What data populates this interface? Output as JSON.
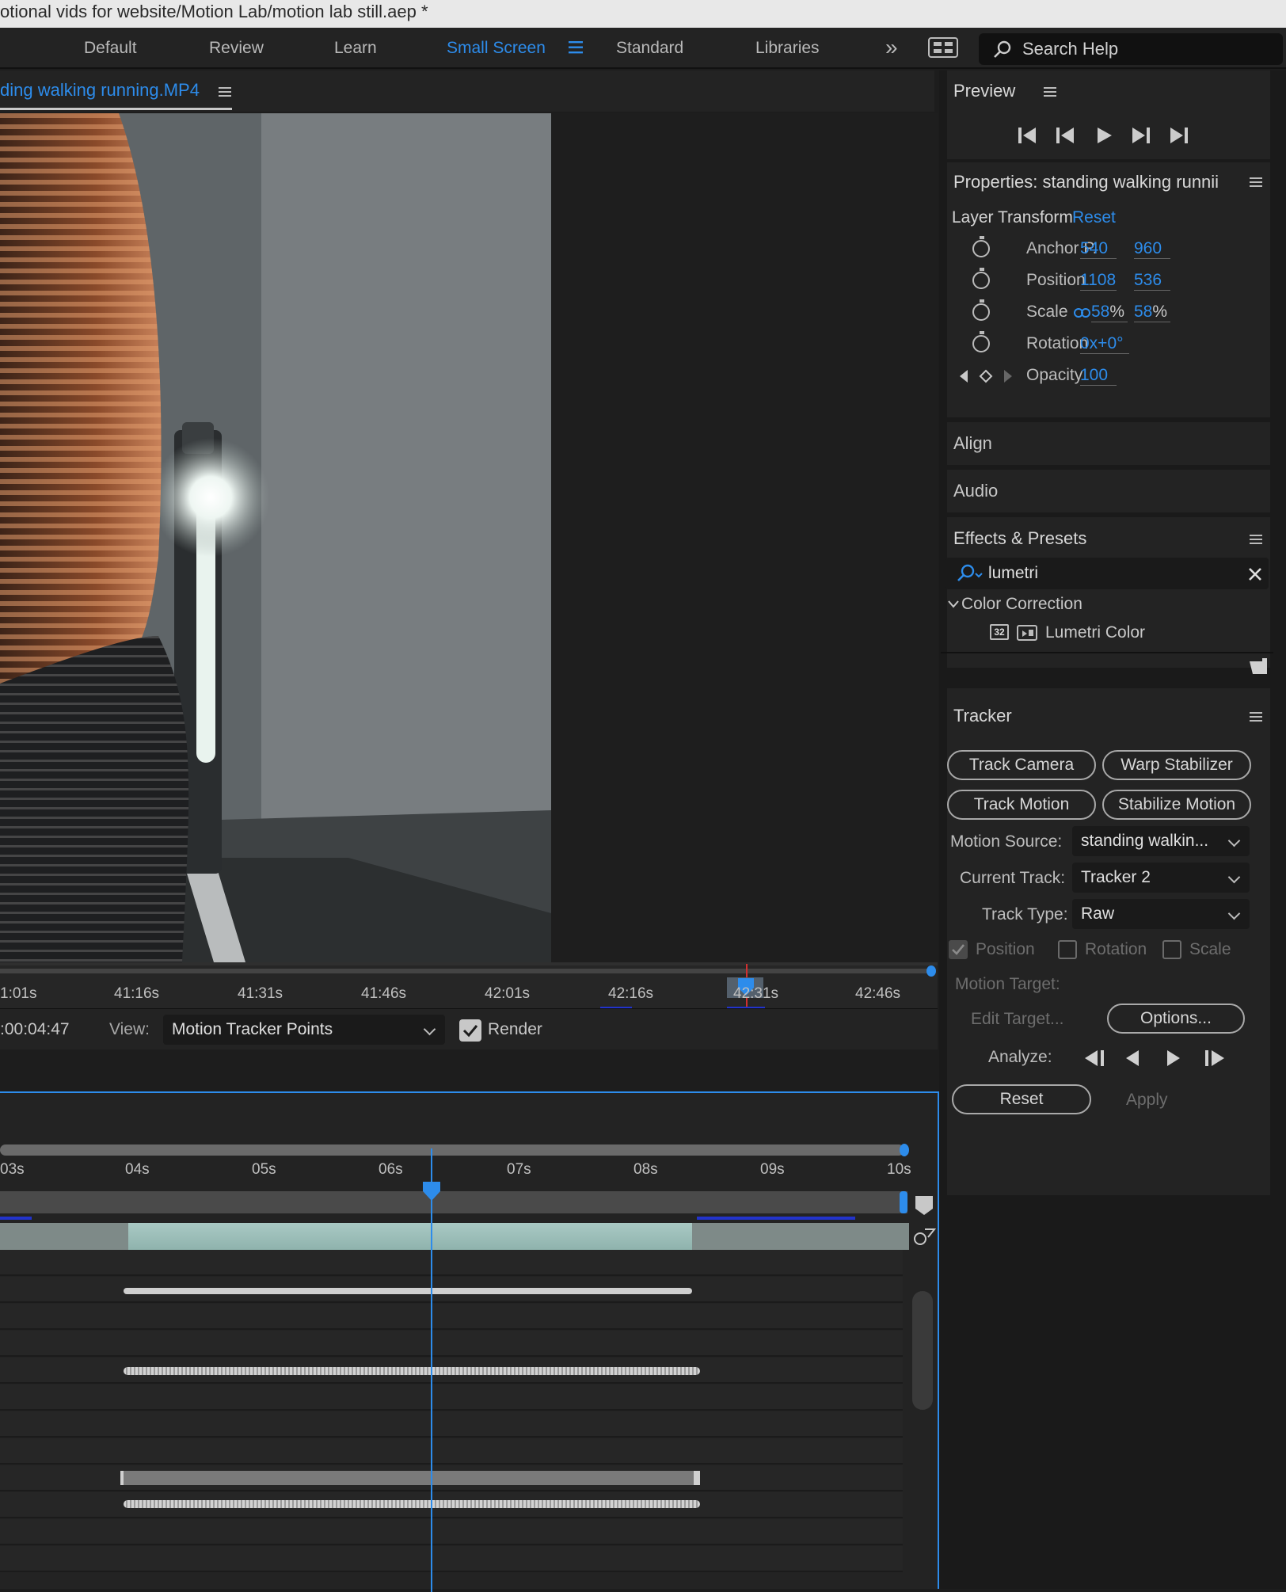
{
  "title_bar": {
    "text": "otional vids for website/Motion Lab/motion lab still.aep *"
  },
  "workspaces": {
    "items": [
      "Default",
      "Review",
      "Learn",
      "Small Screen",
      "Standard",
      "Libraries"
    ],
    "active": "Small Screen",
    "more_glyph": "»"
  },
  "search_help": {
    "placeholder": "Search Help"
  },
  "footage_panel": {
    "tab_label": "ding walking running.MP4"
  },
  "viewer_ruler": {
    "ticks": [
      "1:01s",
      "41:16s",
      "41:31s",
      "41:46s",
      "42:01s",
      "42:16s",
      "42:31s",
      "42:46s"
    ]
  },
  "viewer_bar": {
    "timecode": ":00:04:47",
    "view_label": "View:",
    "view_value": "Motion Tracker Points",
    "render_label": "Render",
    "render_checked": true
  },
  "timeline": {
    "ticks": [
      "03s",
      "04s",
      "05s",
      "06s",
      "07s",
      "08s",
      "09s",
      "10s"
    ]
  },
  "preview": {
    "title": "Preview"
  },
  "properties": {
    "title": "Properties: standing walking runnii",
    "section": "Layer Transform",
    "reset": "Reset",
    "rows": [
      {
        "label": "Anchor P.",
        "v1": "540",
        "v2": "960"
      },
      {
        "label": "Position",
        "v1": "1108",
        "v2": "536"
      },
      {
        "label": "Scale",
        "v1": "58",
        "u1": "%",
        "v2": "58",
        "u2": "%"
      },
      {
        "label": "Rotation",
        "v1": "0x+0°"
      },
      {
        "label": "Opacity",
        "v1": "100"
      }
    ]
  },
  "align": {
    "title": "Align"
  },
  "audio": {
    "title": "Audio"
  },
  "effects_presets": {
    "title": "Effects & Presets",
    "search_value": "lumetri",
    "category": "Color Correction",
    "effect_badge": "32",
    "effect": "Lumetri Color"
  },
  "tracker": {
    "title": "Tracker",
    "buttons": {
      "track_camera": "Track Camera",
      "warp_stabilizer": "Warp Stabilizer",
      "track_motion": "Track Motion",
      "stabilize_motion": "Stabilize Motion"
    },
    "motion_source_label": "Motion Source:",
    "motion_source_value": "standing walkin...",
    "current_track_label": "Current Track:",
    "current_track_value": "Tracker 2",
    "track_type_label": "Track Type:",
    "track_type_value": "Raw",
    "checks": {
      "position": "Position",
      "rotation": "Rotation",
      "scale": "Scale"
    },
    "motion_target_label": "Motion Target:",
    "edit_target": "Edit Target...",
    "options": "Options...",
    "analyze_label": "Analyze:",
    "reset": "Reset",
    "apply": "Apply"
  },
  "colors": {
    "accent": "#2d8ceb",
    "panel": "#232323",
    "background": "#1a1a1a"
  }
}
